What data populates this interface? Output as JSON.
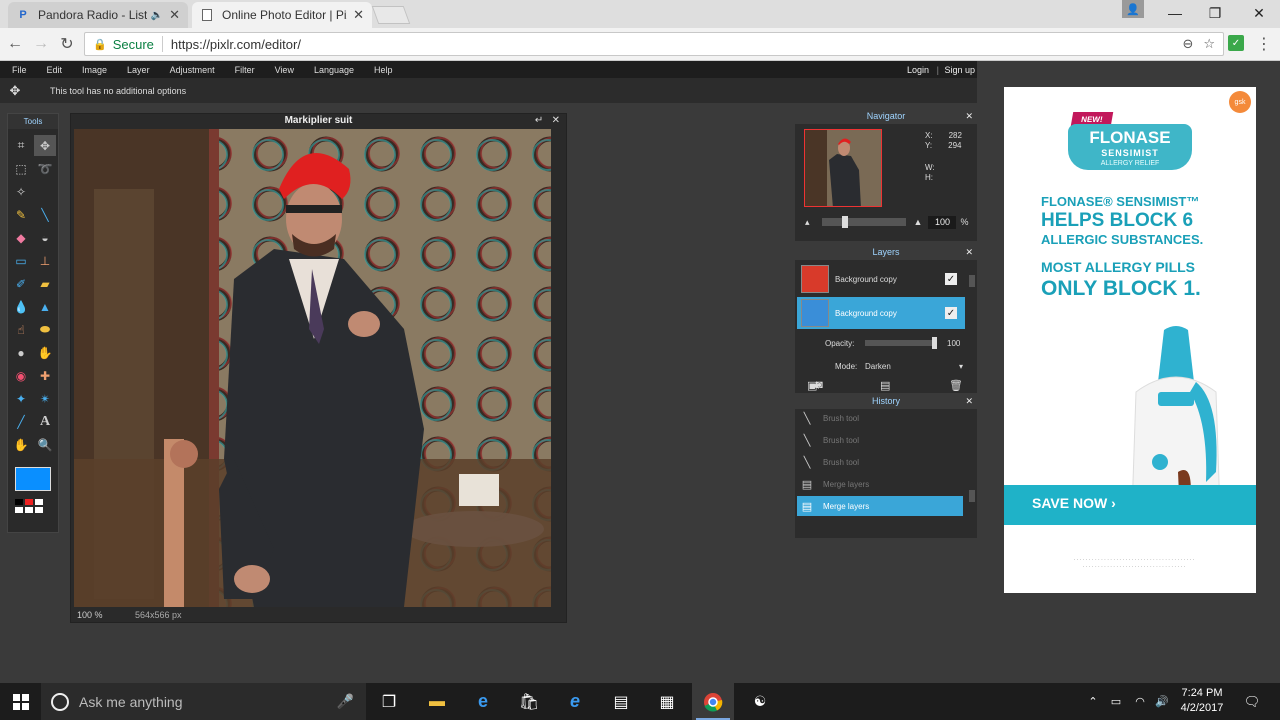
{
  "browser": {
    "tabs": [
      {
        "title": "Pandora Radio - Liste",
        "favicon": "P",
        "audio": true
      },
      {
        "title": "Online Photo Editor | Pix",
        "favicon": "doc"
      }
    ],
    "address": {
      "secure_label": "Secure",
      "url": "https://pixlr.com/editor/"
    }
  },
  "pixlr": {
    "menu": [
      "File",
      "Edit",
      "Image",
      "Layer",
      "Adjustment",
      "Filter",
      "View",
      "Language",
      "Help"
    ],
    "login": "Login",
    "separator": "|",
    "signup": "Sign up",
    "options_text": "This tool has no additional options",
    "tools_title": "Tools",
    "canvas": {
      "title": "Markiplier suit",
      "zoom": "100 %",
      "dims": "564x566 px"
    },
    "navigator": {
      "title": "Navigator",
      "x_label": "X:",
      "x_value": "282",
      "y_label": "Y:",
      "y_value": "294",
      "w_label": "W:",
      "h_label": "H:",
      "zoom": "100",
      "zoom_unit": "%"
    },
    "layers": {
      "title": "Layers",
      "items": [
        {
          "name": "Background copy",
          "checked": "✓"
        },
        {
          "name": "Background copy",
          "checked": "✓"
        }
      ],
      "opacity_label": "Opacity:",
      "opacity_value": "100",
      "mode_label": "Mode:",
      "mode_value": "Darken"
    },
    "history": {
      "title": "History",
      "items": [
        "Brush tool",
        "Brush tool",
        "Brush tool",
        "Merge layers",
        "Merge layers"
      ]
    }
  },
  "ad": {
    "badge": "NEW!",
    "logo_line1": "FLONASE",
    "logo_line2": "SENSIMIST",
    "logo_line3": "ALLERGY RELIEF",
    "line1": "FLONASE® SENSIMIST™",
    "line2": "HELPS BLOCK 6",
    "line3": "ALLERGIC SUBSTANCES.",
    "line4": "MOST ALLERGY PILLS",
    "line5": "ONLY BLOCK 1.",
    "cta": "SAVE NOW ›",
    "corner": "gsk"
  },
  "taskbar": {
    "search_placeholder": "Ask me anything",
    "time": "7:24 PM",
    "date": "4/2/2017"
  },
  "colors": {
    "accent": "#3aa6d8",
    "primary_color": "#0a8fff"
  }
}
